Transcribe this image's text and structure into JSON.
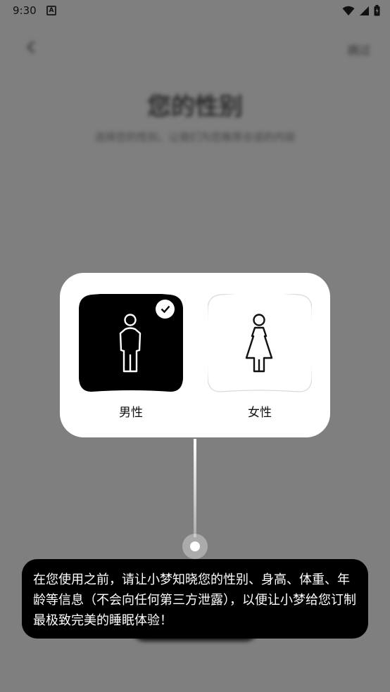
{
  "status_bar": {
    "time": "9:30",
    "notification_icon": "A",
    "icons": [
      "wifi-icon",
      "signal-icon",
      "battery-icon"
    ]
  },
  "background_page": {
    "back_icon": "back-arrow-icon",
    "skip_label": "跳过",
    "title": "您的性别",
    "subtitle": "选择您的性别，让我们为您推荐合适的内容"
  },
  "gender_card": {
    "options": [
      {
        "label": "男性",
        "selected": true,
        "icon": "male-figure-icon"
      },
      {
        "label": "女性",
        "selected": false,
        "icon": "female-figure-icon"
      }
    ],
    "selected_check_icon": "check-icon"
  },
  "tooltip": {
    "text": "在您使用之前，请让小梦知晓您的性别、身高、体重、年龄等信息（不会向任何第三方泄露），以便让小梦给您订制最极致完美的睡眠体验！"
  },
  "colors": {
    "overlay": "#7f7f7f",
    "card_bg": "#ffffff",
    "selected_tile": "#000000",
    "tooltip_bg": "#000000"
  }
}
